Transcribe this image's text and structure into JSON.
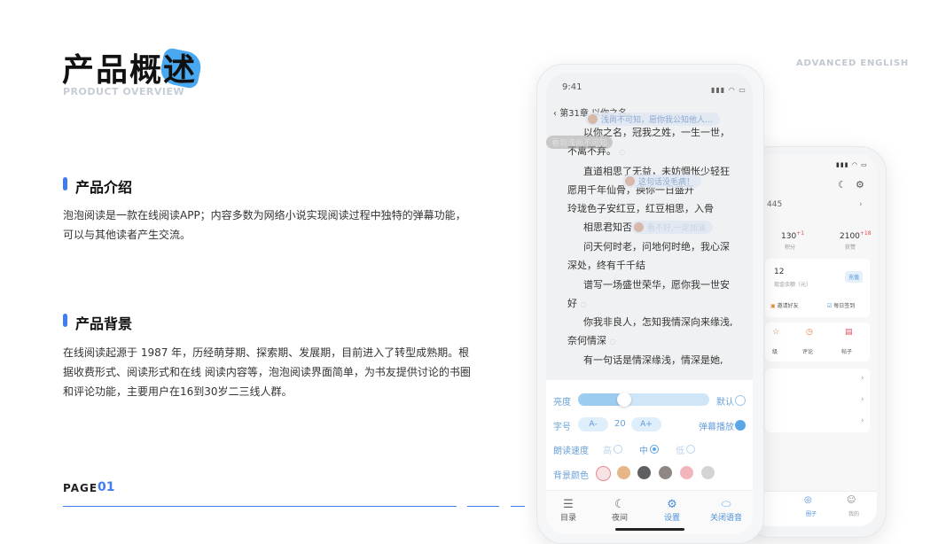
{
  "header": {
    "title": "产品概述",
    "subtitle": "PRODUCT OVERVIEW",
    "top_right": "ADVANCED ENGLISH"
  },
  "sections": [
    {
      "title": "产品介绍",
      "body_lines": [
        "泡泡阅读是一款在线阅读APP；内容多数为网络小说实现阅读过程中独特的弹幕功能，",
        "可以与其他读者产生交流。"
      ]
    },
    {
      "title": "产品背景",
      "body_lines": [
        "在线阅读起源于 1987 年，历经萌芽期、探索期、发展期，目前进入了转型成熟期。根",
        "据收费形式、阅读形式和在线 阅读内容等，泡泡阅读界面简单，为书友提供讨论的书圈",
        "和评论功能，主要用户在16到30岁二三线人群。"
      ]
    }
  ],
  "footer": {
    "page_label": "PAGE",
    "page_number": "01"
  },
  "reader": {
    "time": "9:41",
    "chapter": "第31章 以你之名。",
    "lines": [
      "以你之名，冠我之姓，一生一世，",
      "不离不弃。",
      "直道相思了无益，未妨惆怅少轻狂",
      "愿用千年仙骨，换你一日盛开",
      "玲珑色子安红豆，红豆相思，入骨",
      "相思君知否",
      "问天何时老，问地何时绝，我心深",
      "深处，终有千千结",
      "谱写一场盛世荣华，愿你我一世安",
      "好",
      "你我非良人，怎知我情深向来缘浅,",
      "奈何情深",
      "有一句话是情深缘浅，情深是她,"
    ],
    "danmaku": [
      "浅尚不可知，愿你我公知他人...",
      "看到浅尚不可知",
      "这句话没毛病！",
      "看不好,一定加油"
    ],
    "settings": {
      "brightness_label": "亮度",
      "brightness_value": 0.35,
      "default_label": "默认",
      "font_label": "字号",
      "font_minus": "A-",
      "font_size": "20",
      "font_plus": "A+",
      "danmaku_toggle": "弹幕播放",
      "speed_label": "朗读速度",
      "speed_options": [
        "高",
        "中",
        "低"
      ],
      "speed_selected": "中",
      "bg_label": "背景颜色",
      "bg_colors": [
        "#f8e3e4",
        "#e6b588",
        "#5f5f62",
        "#8f8784",
        "#f3b5bc",
        "#d4d4d4"
      ]
    },
    "nav": [
      {
        "label": "目录",
        "icon": "menu-icon"
      },
      {
        "label": "夜间",
        "icon": "moon-icon"
      },
      {
        "label": "设置",
        "icon": "gear-icon"
      },
      {
        "label": "关闭语音",
        "icon": "toggle-icon"
      }
    ]
  },
  "profile": {
    "id_fragment": "445",
    "stats": [
      {
        "value": "130",
        "delta": "+1",
        "label": "积分"
      },
      {
        "value": "2100",
        "delta": "+18",
        "label": "获赞"
      }
    ],
    "balance": "12",
    "balance_label": "现金余额（元）",
    "recharge": "充值",
    "invite": "邀请好友",
    "checkin": "每日签到",
    "grid": [
      "级",
      "评论",
      "帖子"
    ],
    "nav": [
      "圈子",
      "我的"
    ]
  }
}
